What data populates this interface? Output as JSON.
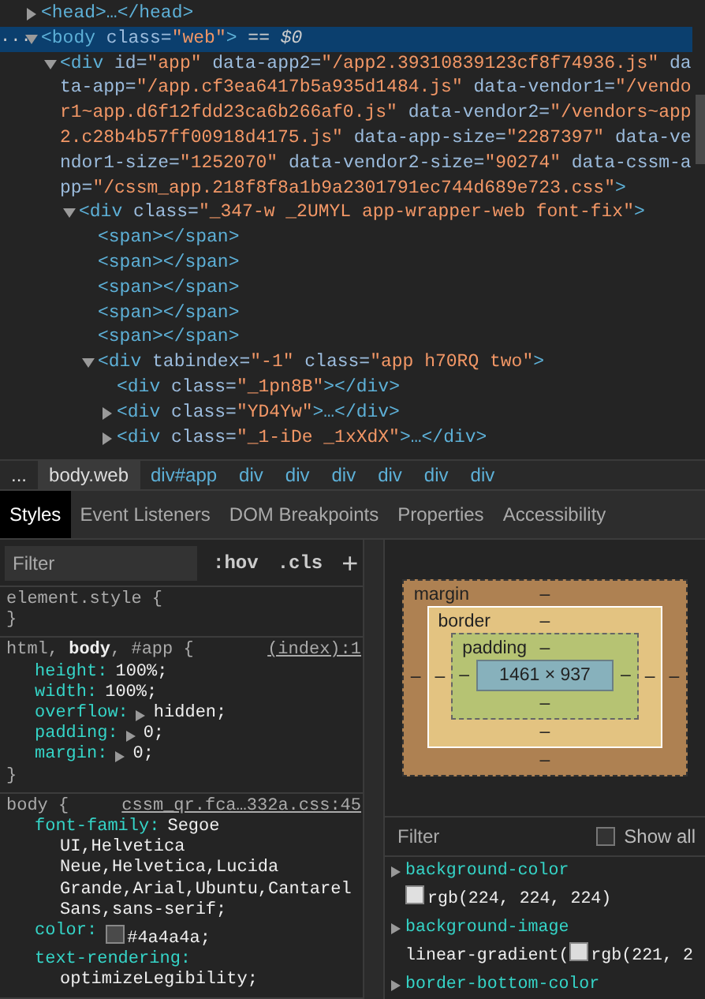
{
  "elements": [
    {
      "open": "<head>",
      "close": "…</head>",
      "expanded": false,
      "selected": false
    },
    {
      "gutter": "...",
      "open": "<body",
      "attrs": [
        {
          "name": "class=",
          "value": "\"web\""
        }
      ],
      "close": ">",
      "tail": "== $0",
      "expanded": true,
      "selected": true,
      "children": [
        {
          "open": "<div",
          "attrs": [
            {
              "name": "id=",
              "value": "\"app\""
            },
            {
              "name": "data-app2=",
              "value": "\"/app2.39310839123cf8f74936.js\""
            },
            {
              "name": "data-app=",
              "value": "\"/app.cf3ea6417b5a935d1484.js\""
            },
            {
              "name": "data-vendor1=",
              "value": "\"/vendor1~app.d6f12fdd23ca6b266af0.js\""
            },
            {
              "name": "data-vendor2=",
              "value": "\"/vendors~app2.c28b4b57ff00918d4175.js\""
            },
            {
              "name": "data-app-size=",
              "value": "\"2287397\""
            },
            {
              "name": "data-vendor1-size=",
              "value": "\"1252070\""
            },
            {
              "name": "data-vendor2-size=",
              "value": "\"90274\""
            },
            {
              "name": "data-cssm-app=",
              "value": "\"/cssm_app.218f8f8a1b9a2301791ec744d689e723.css\""
            }
          ],
          "close": ">",
          "expanded": true,
          "selected": false,
          "children": [
            {
              "open": "<div",
              "attrs": [
                {
                  "name": "class=",
                  "value": "\"_347-w _2UMYL app-wrapper-web font-fix\""
                }
              ],
              "close": ">",
              "expanded": true,
              "selected": false,
              "children": [
                {
                  "open": "<span",
                  "close": "></span>",
                  "selected": false
                },
                {
                  "open": "<span",
                  "close": "></span>",
                  "selected": false
                },
                {
                  "open": "<span",
                  "close": "></span>",
                  "selected": false
                },
                {
                  "open": "<span",
                  "close": "></span>",
                  "selected": false
                },
                {
                  "open": "<span",
                  "close": "></span>",
                  "selected": false
                },
                {
                  "open": "<div",
                  "attrs": [
                    {
                      "name": "tabindex=",
                      "value": "\"-1\""
                    },
                    {
                      "name": "class=",
                      "value": "\"app h70RQ two\""
                    }
                  ],
                  "close": ">",
                  "expanded": true,
                  "selected": false,
                  "children": [
                    {
                      "open": "<div",
                      "attrs": [
                        {
                          "name": "class=",
                          "value": "\"_1pn8B\""
                        }
                      ],
                      "close": "></div>",
                      "selected": false
                    },
                    {
                      "open": "<div",
                      "attrs": [
                        {
                          "name": "class=",
                          "value": "\"YD4Yw\""
                        }
                      ],
                      "close": ">…</div>",
                      "expanded": false,
                      "selected": false
                    },
                    {
                      "open": "<div",
                      "attrs": [
                        {
                          "name": "class=",
                          "value": "\"_1-iDe _1xXdX\""
                        }
                      ],
                      "close": ">…</div>",
                      "expanded": false,
                      "selected": false
                    }
                  ]
                }
              ]
            }
          ]
        }
      ]
    }
  ],
  "breadcrumbs": [
    {
      "text": "...",
      "kind": "more",
      "selected": false
    },
    {
      "text": "body.web",
      "kind": "tag",
      "selected": true
    },
    {
      "text": "div#app",
      "kind": "id",
      "selected": false
    },
    {
      "text": "div",
      "kind": "tag",
      "selected": false
    },
    {
      "text": "div",
      "kind": "tag",
      "selected": false
    },
    {
      "text": "div",
      "kind": "tag",
      "selected": false
    },
    {
      "text": "div",
      "kind": "tag",
      "selected": false
    },
    {
      "text": "div",
      "kind": "tag",
      "selected": false
    },
    {
      "text": "div",
      "kind": "tag",
      "selected": false
    }
  ],
  "tabs": [
    {
      "label": "Styles",
      "selected": true
    },
    {
      "label": "Event Listeners",
      "selected": false
    },
    {
      "label": "DOM Breakpoints",
      "selected": false
    },
    {
      "label": "Properties",
      "selected": false
    },
    {
      "label": "Accessibility",
      "selected": false
    }
  ],
  "styles_toolbar": {
    "filter_placeholder": "Filter",
    "hov": ":hov",
    "cls": ".cls",
    "add": "+"
  },
  "rules": [
    {
      "selector": "element.style {",
      "close": "}"
    },
    {
      "selector": "html, **body**, #app {",
      "source": "(index):1",
      "close": "}",
      "properties": [
        {
          "name": "height:",
          "value": "100%;"
        },
        {
          "name": "width:",
          "value": "100%;"
        },
        {
          "name": "overflow:",
          "value": "hidden;",
          "expandable": true
        },
        {
          "name": "padding:",
          "value": "0;",
          "expandable": true
        },
        {
          "name": "margin:",
          "value": "0;",
          "expandable": true
        }
      ]
    },
    {
      "selector": "body {",
      "source": "cssm_qr.fca…332a.css:45",
      "properties": [
        {
          "name": "font-family:",
          "value": "Segoe",
          "more_lines": [
            "UI,Helvetica",
            "Neue,Helvetica,Lucida",
            "Grande,Arial,Ubuntu,Cantarel",
            "Sans,sans-serif;"
          ]
        },
        {
          "name": "color:",
          "value": "#4a4a4a;",
          "color": "#4a4a4a"
        },
        {
          "name": "text-rendering:",
          "more_lines": [
            "optimizeLegibility;"
          ]
        }
      ]
    }
  ],
  "box_model": {
    "margin": {
      "label": "margin",
      "top": "–",
      "right": "–",
      "bottom": "–",
      "left": "–"
    },
    "border": {
      "label": "border",
      "top": "–",
      "right": "–",
      "bottom": "–",
      "left": "–"
    },
    "padding": {
      "label": "padding",
      "top": "–",
      "right": "–",
      "bottom": "–",
      "left": "–"
    },
    "content": "1461 × 937"
  },
  "computed": {
    "filter_placeholder": "Filter",
    "show_all": {
      "label": "Show all",
      "checked": false
    },
    "properties": [
      {
        "name": "background-color",
        "value": "rgb(224, 224, 224)",
        "color": "#e0e0e0"
      },
      {
        "name": "background-image",
        "value_before": "linear-gradient(",
        "value": "rgb(221, 2",
        "color": "#dddddd"
      },
      {
        "name": "border-bottom-color"
      }
    ]
  }
}
